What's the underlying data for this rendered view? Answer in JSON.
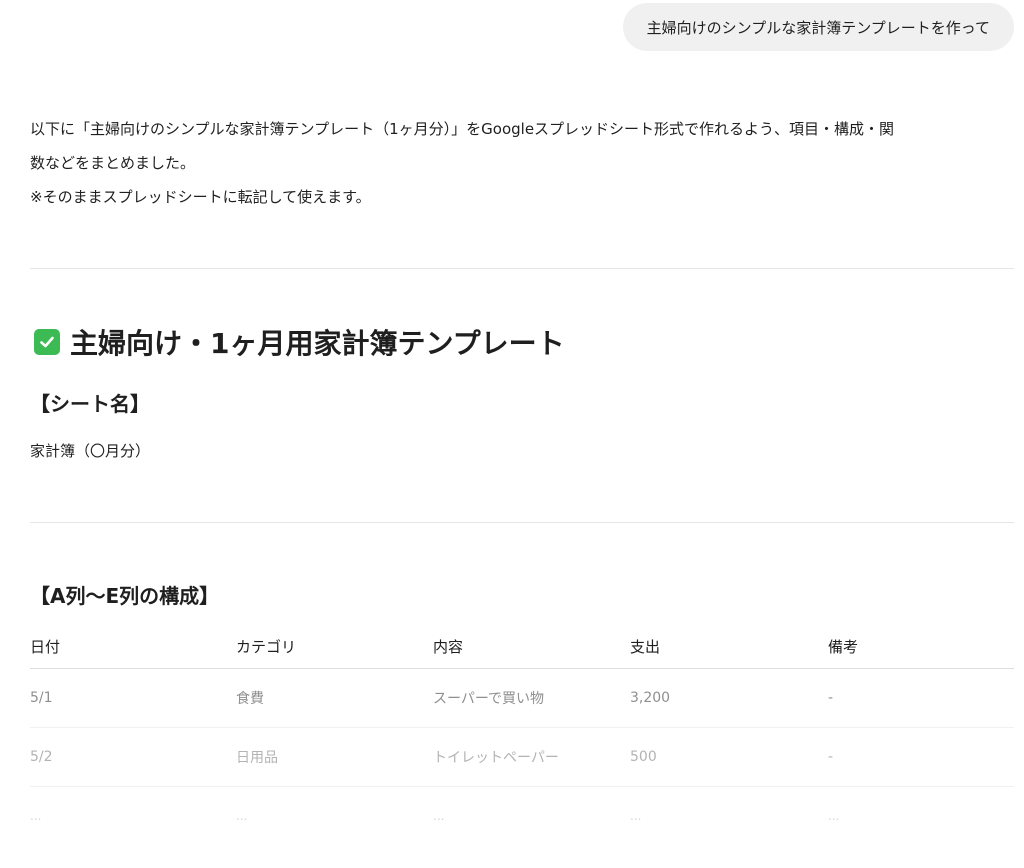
{
  "user_message": {
    "text": "主婦向けのシンプルな家計簿テンプレートを作って"
  },
  "answer": {
    "intro_lines": [
      "以下に「主婦向けのシンプルな家計簿テンプレート（1ヶ月分）」をGoogleスプレッドシート形式で作れるよう、項目・構成・関",
      "数などをまとめました。",
      "※そのままスプレッドシートに転記して使えます。"
    ],
    "section_title": "主婦向け・1ヶ月用家計簿テンプレート",
    "section_icon": "check-mark-icon",
    "sheet_name_heading": "【シート名】",
    "sheet_name_value": "家計簿（〇月分）",
    "columns_heading": "【A列〜E列の構成】",
    "table": {
      "headers": [
        "日付",
        "カテゴリ",
        "内容",
        "支出",
        "備考"
      ],
      "rows": [
        [
          "5/1",
          "食費",
          "スーパーで買い物",
          "3,200",
          "-"
        ],
        [
          "5/2",
          "日用品",
          "トイレットペーパー",
          "500",
          "-"
        ],
        [
          "...",
          "...",
          "...",
          "...",
          "..."
        ]
      ]
    }
  },
  "colors": {
    "user_bubble_bg": "#f0f0f0",
    "check_icon_bg": "#3cba54",
    "divider": "#e6e6e6",
    "text": "#1f1f1f"
  }
}
